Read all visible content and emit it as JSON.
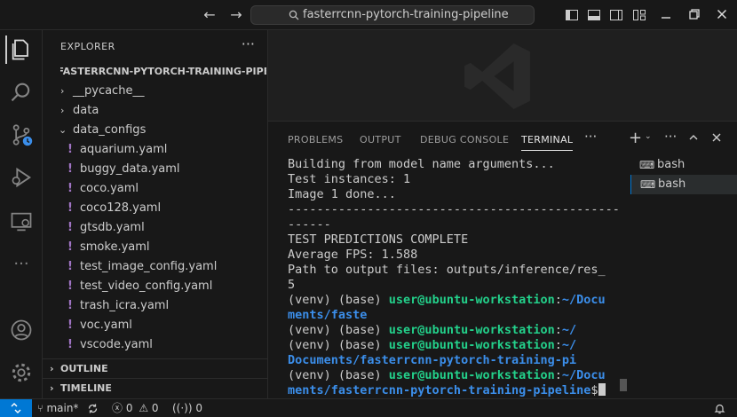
{
  "titlebar": {
    "search_text": "fasterrcnn-pytorch-training-pipeline",
    "back_icon": "arrow-left-icon",
    "forward_icon": "arrow-right-icon"
  },
  "explorer": {
    "header": "EXPLORER",
    "more": "···",
    "root": "FASTERRCNN-PYTORCH-TRAINING-PIPELI...",
    "items": [
      {
        "label": "__pycache__",
        "type": "folder",
        "expanded": false
      },
      {
        "label": "data",
        "type": "folder",
        "expanded": false
      },
      {
        "label": "data_configs",
        "type": "folder",
        "expanded": true
      },
      {
        "label": "aquarium.yaml",
        "type": "yaml"
      },
      {
        "label": "buggy_data.yaml",
        "type": "yaml"
      },
      {
        "label": "coco.yaml",
        "type": "yaml"
      },
      {
        "label": "coco128.yaml",
        "type": "yaml"
      },
      {
        "label": "gtsdb.yaml",
        "type": "yaml"
      },
      {
        "label": "smoke.yaml",
        "type": "yaml"
      },
      {
        "label": "test_image_config.yaml",
        "type": "yaml"
      },
      {
        "label": "test_video_config.yaml",
        "type": "yaml"
      },
      {
        "label": "trash_icra.yaml",
        "type": "yaml"
      },
      {
        "label": "voc.yaml",
        "type": "yaml"
      },
      {
        "label": "vscode.yaml",
        "type": "yaml"
      }
    ],
    "outline": "OUTLINE",
    "timeline": "TIMELINE"
  },
  "panel": {
    "tabs": [
      "PROBLEMS",
      "OUTPUT",
      "DEBUG CONSOLE",
      "TERMINAL"
    ],
    "active_tab": "TERMINAL",
    "more": "···",
    "terminals": [
      "bash",
      "bash"
    ]
  },
  "terminal": {
    "lines": [
      "Building from model name arguments...",
      "Test instances: 1",
      "Image 1 done...",
      "------------------------------------------------",
      "------",
      "TEST PREDICTIONS COMPLETE",
      "Average FPS: 1.588",
      "Path to output files: outputs/inference/res_",
      "5"
    ],
    "prompt_env": "(venv) (base) ",
    "user": "user@ubuntu-workstation",
    "prompt1_path_a": "~/Docu",
    "prompt1_path_b": "ments/faste",
    "prompt2_path": "~/",
    "prompt3_path": "~/",
    "prompt3_path_b": "Documents/fasterrcnn-pytorch-training-pi",
    "prompt4_path_a": "~/Docu",
    "prompt4_path_b": "ments/fasterrcnn-pytorch-training-pipeline",
    "dollar": "$"
  },
  "statusbar": {
    "branch": "main*",
    "errors": "0",
    "warnings": "0",
    "ports": "0"
  },
  "colors": {
    "accent": "#0078d4",
    "terminal_green": "#23d18b",
    "terminal_blue": "#3b8eea",
    "yaml": "#a074c4"
  }
}
